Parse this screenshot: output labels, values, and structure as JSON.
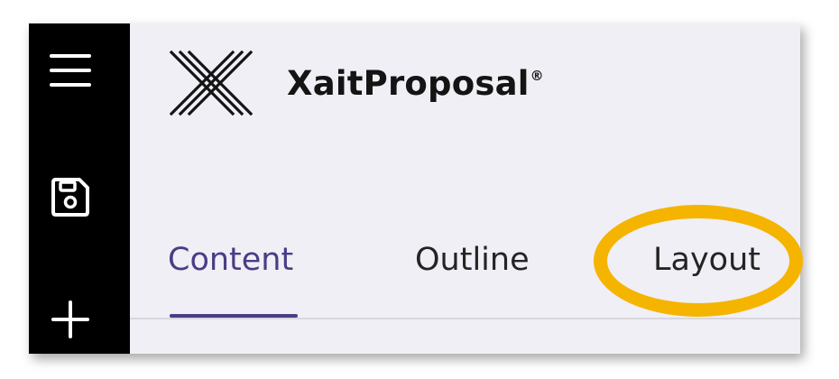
{
  "app": {
    "name": "XaitProposal",
    "reg_mark": "®"
  },
  "rail": {
    "items": [
      {
        "icon": "menu-icon"
      },
      {
        "icon": "save-icon"
      },
      {
        "icon": "plus-icon"
      }
    ]
  },
  "tabs": [
    {
      "label": "Content",
      "active": true
    },
    {
      "label": "Outline",
      "active": false
    },
    {
      "label": "Layout",
      "active": false
    }
  ],
  "annotation": {
    "type": "highlight-ellipse",
    "target": "tab-layout",
    "color": "#F5B400"
  },
  "colors": {
    "rail": "#000000",
    "panel": "#F0EFF5",
    "accent": "#4B3C86"
  }
}
